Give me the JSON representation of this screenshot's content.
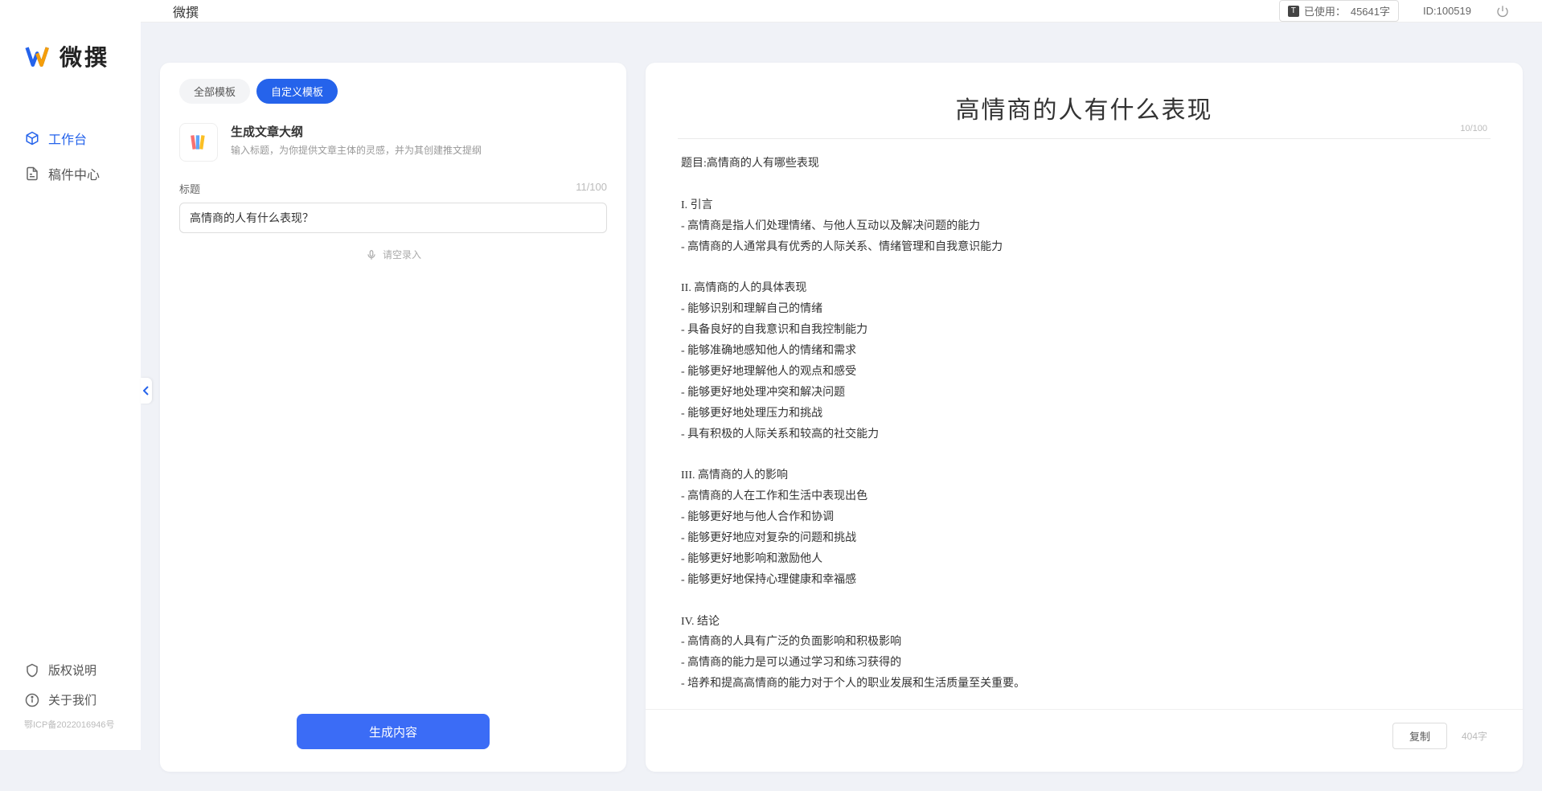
{
  "brand": {
    "name": "微撰"
  },
  "topbar": {
    "title": "微撰",
    "usage_prefix": "已使用：",
    "usage_value": "45641字",
    "id_label": "ID:100519"
  },
  "sidebar": {
    "items": [
      {
        "label": "工作台"
      },
      {
        "label": "稿件中心"
      }
    ],
    "footer": [
      {
        "label": "版权说明"
      },
      {
        "label": "关于我们"
      }
    ],
    "icp": "鄂ICP备2022016946号"
  },
  "leftPanel": {
    "tabs": {
      "all": "全部模板",
      "custom": "自定义模板"
    },
    "card": {
      "title": "生成文章大纲",
      "desc": "输入标题，为你提供文章主体的灵感，并为其创建推文提纲"
    },
    "field": {
      "label": "标题",
      "count": "11/100",
      "value": "高情商的人有什么表现？"
    },
    "voice_hint": "请空录入",
    "generate": "生成内容"
  },
  "output": {
    "title": "高情商的人有什么表现",
    "top_count": "10/100",
    "body": "题目:高情商的人有哪些表现\n\nI. 引言\n- 高情商是指人们处理情绪、与他人互动以及解决问题的能力\n- 高情商的人通常具有优秀的人际关系、情绪管理和自我意识能力\n\nII. 高情商的人的具体表现\n- 能够识别和理解自己的情绪\n- 具备良好的自我意识和自我控制能力\n- 能够准确地感知他人的情绪和需求\n- 能够更好地理解他人的观点和感受\n- 能够更好地处理冲突和解决问题\n- 能够更好地处理压力和挑战\n- 具有积极的人际关系和较高的社交能力\n\nIII. 高情商的人的影响\n- 高情商的人在工作和生活中表现出色\n- 能够更好地与他人合作和协调\n- 能够更好地应对复杂的问题和挑战\n- 能够更好地影响和激励他人\n- 能够更好地保持心理健康和幸福感\n\nIV. 结论\n- 高情商的人具有广泛的负面影响和积极影响\n- 高情商的能力是可以通过学习和练习获得的\n- 培养和提高高情商的能力对于个人的职业发展和生活质量至关重要。",
    "copy": "复制",
    "char_count": "404字"
  }
}
